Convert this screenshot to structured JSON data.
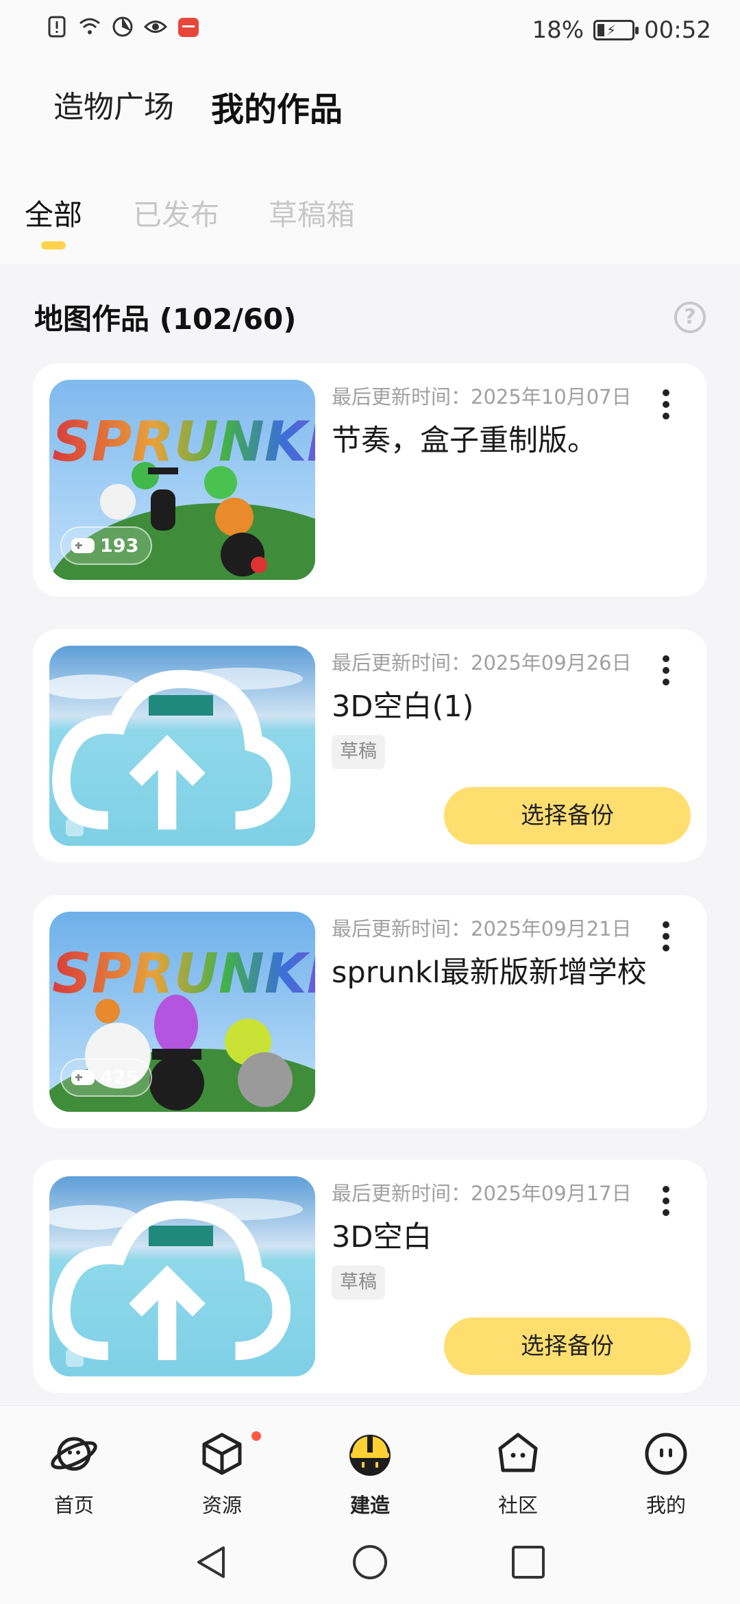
{
  "status_bar": {
    "battery": "18%",
    "time": "00:52"
  },
  "header": {
    "tabs": [
      "造物广场",
      "我的作品"
    ],
    "active_tab": "我的作品",
    "subtabs": [
      "全部",
      "已发布",
      "草稿箱"
    ],
    "active_subtab": "全部"
  },
  "section": {
    "title": "地图作品 (102/60)",
    "help": "?"
  },
  "works": [
    {
      "updated": "最后更新时间：2025年10月07日",
      "title": "节奏，盒子重制版。",
      "plays": "193",
      "thumb_text": "SPRUNKL"
    },
    {
      "updated": "最后更新时间：2025年09月26日",
      "title": "3D空白(1)",
      "badge": "草稿",
      "button": "选择备份"
    },
    {
      "updated": "最后更新时间：2025年09月21日",
      "title": "sprunkl最新版新增学校",
      "plays": "425",
      "thumb_text": "SPRUNKL"
    },
    {
      "updated": "最后更新时间：2025年09月17日",
      "title": "3D空白",
      "badge": "草稿",
      "button": "选择备份"
    }
  ],
  "bottom_nav": [
    "首页",
    "资源",
    "建造",
    "社区",
    "我的"
  ],
  "active_nav": "建造",
  "accent_color": "#ffde70",
  "dot_color": "#ff5a45"
}
